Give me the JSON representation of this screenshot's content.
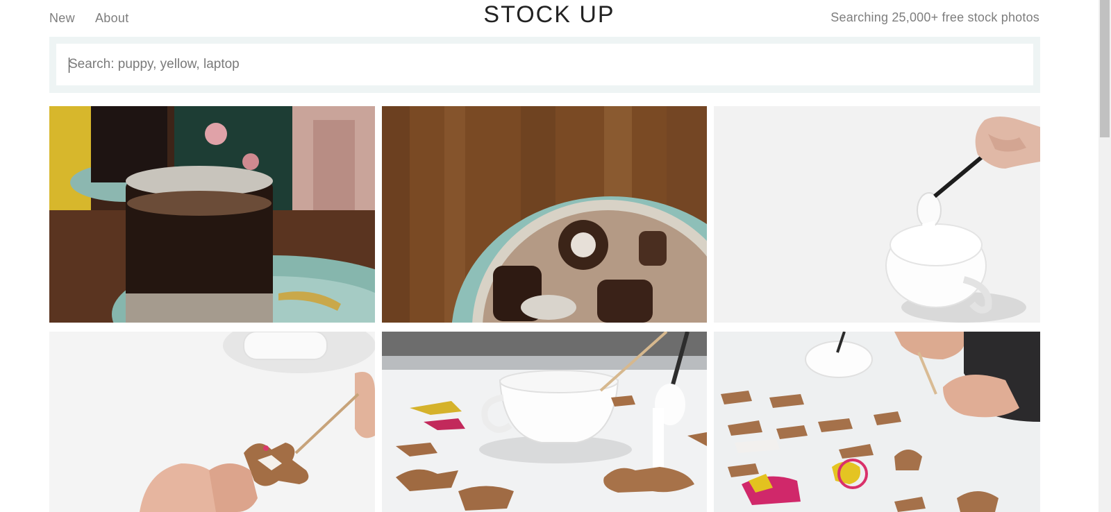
{
  "header": {
    "nav": [
      {
        "label": "New"
      },
      {
        "label": "About"
      }
    ],
    "logo": "STOCK UP",
    "tagline": "Searching 25,000+ free stock photos"
  },
  "search": {
    "placeholder": "Search: puppy, yellow, laptop",
    "value": ""
  },
  "photos": [
    {
      "subject": "iced coffee in glass on saucer"
    },
    {
      "subject": "iced coffee with milk viewed from above"
    },
    {
      "subject": "spoon dipping into cup of white icing"
    },
    {
      "subject": "decorating gingerbread cookie with icing stick"
    },
    {
      "subject": "spoon dripping icing onto cookie"
    },
    {
      "subject": "hands decorating rows of animal cookies"
    }
  ],
  "icons": {
    "photo": "image-icon"
  },
  "colors": {
    "search_background": "#eef4f4",
    "nav_text": "#7d7d7d",
    "logo_text": "#222222"
  }
}
